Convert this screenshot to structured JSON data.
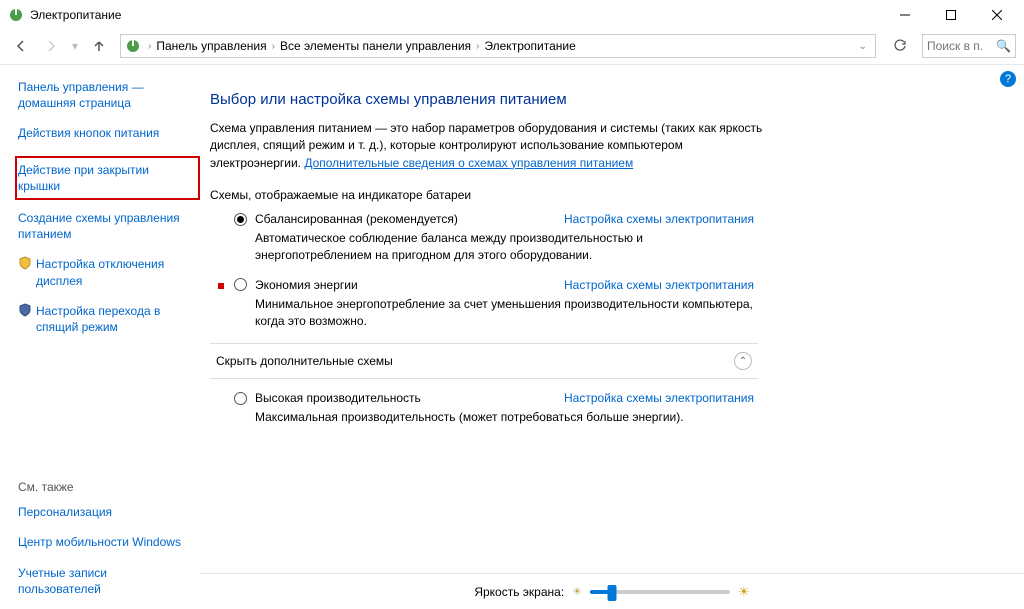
{
  "title": "Электропитание",
  "breadcrumb": {
    "parts": [
      "Панель управления",
      "Все элементы панели управления",
      "Электропитание"
    ]
  },
  "search": {
    "placeholder": "Поиск в п..."
  },
  "sidebar": {
    "home": "Панель управления — домашняя страница",
    "buttons": "Действия кнопок питания",
    "lid": "Действие при закрытии крышки",
    "create": "Создание схемы управления питанием",
    "display": "Настройка отключения дисплея",
    "sleep": "Настройка перехода в спящий режим",
    "seealso_title": "См. также",
    "seealso": [
      "Персонализация",
      "Центр мобильности Windows",
      "Учетные записи пользователей"
    ]
  },
  "main": {
    "heading": "Выбор или настройка схемы управления питанием",
    "desc": "Схема управления питанием — это набор параметров оборудования и системы (таких как яркость дисплея, спящий режим и т. д.), которые контролируют использование компьютером электроэнергии.",
    "desclink": "Дополнительные сведения о схемах управления питанием",
    "displayed": "Схемы, отображаемые на индикаторе батареи",
    "plan_link": "Настройка схемы электропитания",
    "plan1": {
      "name": "Сбалансированная (рекомендуется)",
      "desc": "Автоматическое соблюдение баланса между производительностью и энергопотреблением на пригодном для этого оборудовании."
    },
    "plan2": {
      "name": "Экономия энергии",
      "desc": "Минимальное энергопотребление за счет уменьшения производительности компьютера, когда это возможно."
    },
    "hide": "Скрыть дополнительные схемы",
    "plan3": {
      "name": "Высокая производительность",
      "desc": "Максимальная производительность (может потребоваться больше энергии)."
    }
  },
  "bottom": {
    "brightness": "Яркость экрана:"
  }
}
